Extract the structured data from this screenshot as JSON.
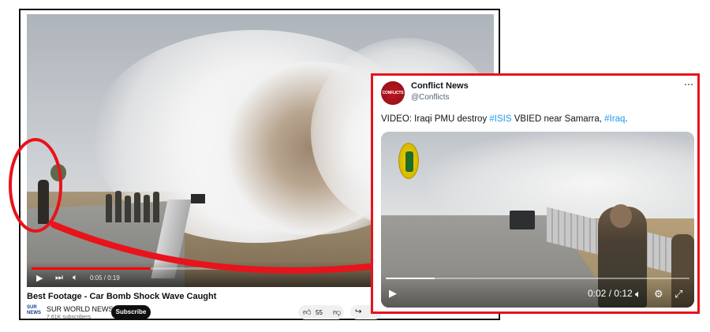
{
  "youtube": {
    "title": "Best Footage - Car Bomb Shock Wave Caught",
    "channel_name": "SUR WORLD NEWS",
    "channel_logo_text": "SUR NEWS",
    "subscribers": "7.61K subscribers",
    "subscribe_label": "Subscribe",
    "like_count": "55",
    "time_display": "0:05 / 0:19",
    "progress": 0.26,
    "icons": [
      "play-icon",
      "next-icon",
      "volume-icon",
      "like-icon",
      "dislike-icon",
      "share-icon"
    ]
  },
  "tweet": {
    "author_name": "Conflict News",
    "handle": "@Conflicts",
    "avatar_text": "CONFLICTS",
    "text_prefix": "VIDEO: Iraqi PMU destroy ",
    "hashtag_1": "#ISIS",
    "text_middle": " VBIED near Samarra, ",
    "hashtag_2": "#Iraq",
    "text_suffix": ".",
    "more_icon": "⋯",
    "time_display": "0:02 / 0:12",
    "progress": 0.16,
    "icons": [
      "play-icon",
      "volume-icon",
      "settings-icon",
      "fullscreen-icon"
    ]
  },
  "colors": {
    "highlight_red": "#e8131b",
    "hashtag_blue": "#1d9bf0",
    "youtube_red": "#ff0000"
  }
}
